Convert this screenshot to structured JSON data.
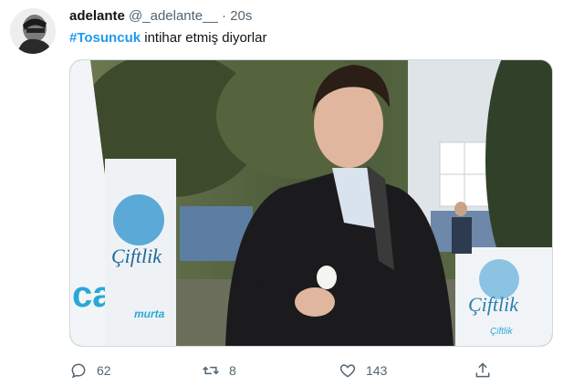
{
  "tweet": {
    "display_name": "adelante",
    "handle": "@_adelante__",
    "separator": "·",
    "timestamp": "20s",
    "hashtag": "#Tosuncuk",
    "text": " intihar etmiş diyorlar"
  },
  "media": {
    "banner_brand": "Çiftlik",
    "banner_left_fragment": "ca",
    "banner_left_sub": "murta",
    "banner_right_sub": "Çiftlik"
  },
  "actions": {
    "reply_count": "62",
    "retweet_count": "8",
    "like_count": "143"
  },
  "icons": {
    "reply": "reply-icon",
    "retweet": "retweet-icon",
    "like": "like-icon",
    "share": "share-icon"
  },
  "colors": {
    "hashtag": "#1d9bf0",
    "secondary_text": "#536471"
  }
}
